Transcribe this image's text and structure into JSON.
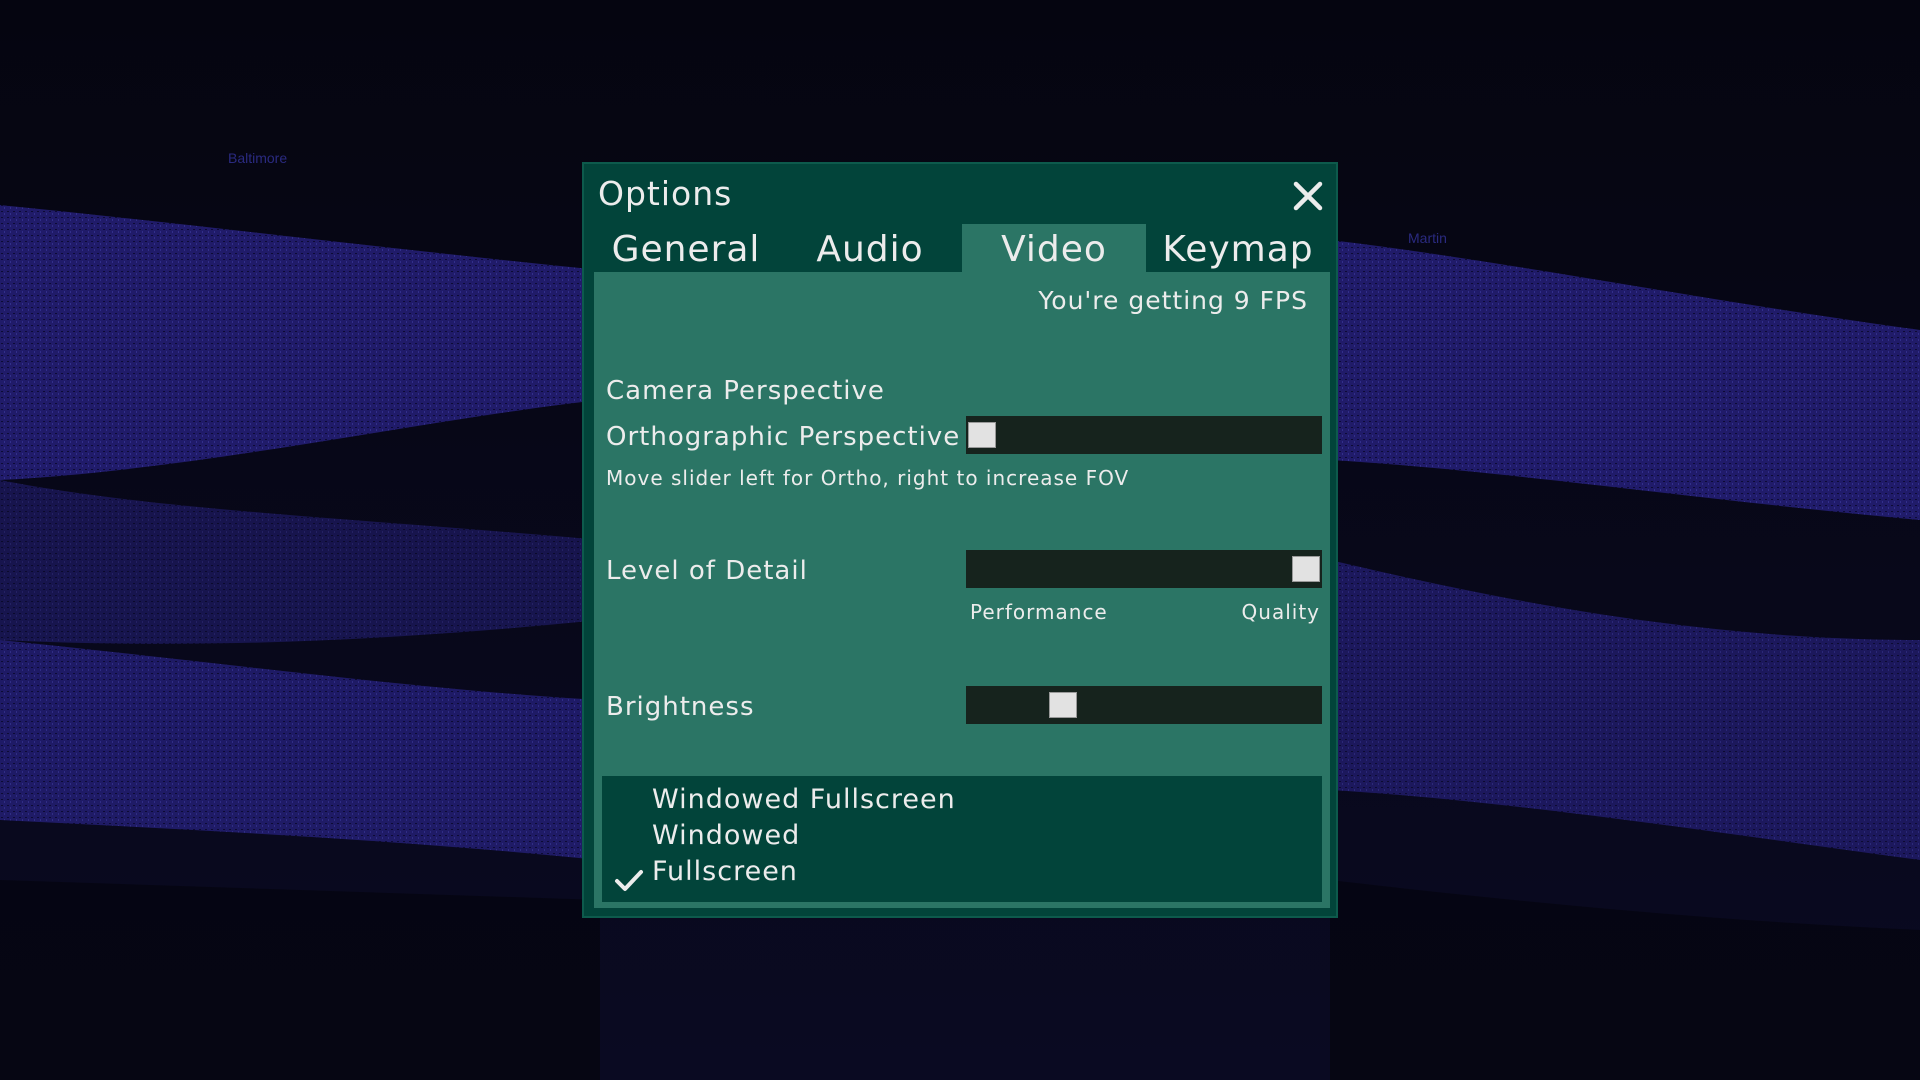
{
  "map_labels": [
    "Baltimore",
    "Martin"
  ],
  "window": {
    "title": "Options",
    "close_icon": "close-icon"
  },
  "tabs": [
    {
      "label": "General",
      "active": false
    },
    {
      "label": "Audio",
      "active": false
    },
    {
      "label": "Video",
      "active": true
    },
    {
      "label": "Keymap",
      "active": false
    }
  ],
  "video": {
    "fps_text": "You're getting 9 FPS",
    "camera_heading": "Camera Perspective",
    "camera_slider_label": "Orthographic Perspective",
    "camera_slider_value": 0.0,
    "camera_hint": "Move slider left for Ortho, right to increase FOV",
    "lod_label": "Level of Detail",
    "lod_value": 1.0,
    "lod_min_label": "Performance",
    "lod_max_label": "Quality",
    "brightness_label": "Brightness",
    "brightness_value": 0.25,
    "display_modes": [
      {
        "label": "Windowed Fullscreen",
        "selected": false
      },
      {
        "label": "Windowed",
        "selected": false
      },
      {
        "label": "Fullscreen",
        "selected": true
      }
    ]
  },
  "colors": {
    "window_bg": "#02443a",
    "panel_bg": "#2b7565",
    "slider_track": "#16231d",
    "thumb": "#e2e2e2",
    "text": "#ececec",
    "terrain": "#22206e"
  }
}
